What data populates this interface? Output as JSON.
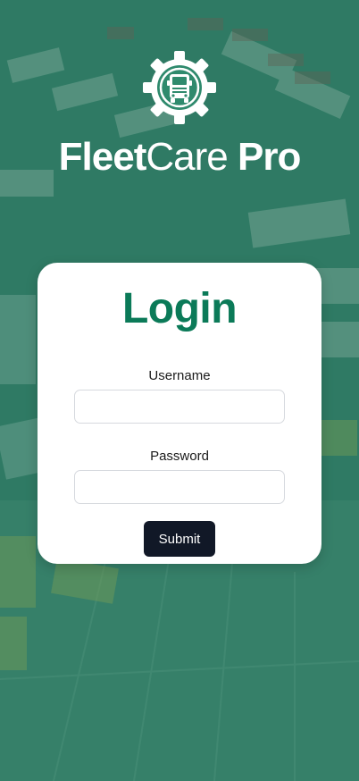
{
  "brand": {
    "name_part1": "Fleet",
    "name_part2": "Care",
    "name_part3": "Pro",
    "logo_icon": "gear-truck-icon"
  },
  "login_card": {
    "title": "Login",
    "username_label": "Username",
    "username_value": "",
    "username_placeholder": "",
    "password_label": "Password",
    "password_value": "",
    "password_placeholder": "",
    "submit_label": "Submit"
  },
  "colors": {
    "overlay_green": "#2d7a64",
    "title_green": "#0b7a58",
    "button_dark": "#111827",
    "white": "#ffffff"
  }
}
